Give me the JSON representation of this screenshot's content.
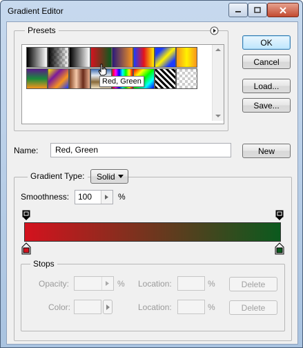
{
  "window": {
    "title": "Gradient Editor"
  },
  "titlebar": {
    "min_icon": "minimize-icon",
    "max_icon": "maximize-icon",
    "close_icon": "close-icon"
  },
  "presets": {
    "label": "Presets",
    "menu_icon": "flyout-menu-icon",
    "tooltip": "Red, Green",
    "swatches_row1": [
      {
        "name": "foreground-to-background",
        "css": "linear-gradient(to right,#000,#fff)"
      },
      {
        "name": "foreground-to-transparent",
        "css": "linear-gradient(to right,#000,rgba(0,0,0,0))"
      },
      {
        "name": "black-white",
        "css": "linear-gradient(to right,#000,#fff)"
      },
      {
        "name": "red-green",
        "css": "linear-gradient(to right,#d4121e,#0b5a1e)"
      },
      {
        "name": "violet-orange",
        "css": "linear-gradient(to right,#2a1a7a,#f7941d)"
      },
      {
        "name": "blue-red-yellow",
        "css": "linear-gradient(to right,#1c3cff,#e4141e,#fff200)"
      },
      {
        "name": "blue-yellow-blue",
        "css": "linear-gradient(135deg,#1c3cff 20%,#fff200 50%,#1c3cff 80%)"
      },
      {
        "name": "orange-yellow-orange",
        "css": "linear-gradient(to right,#f7941d,#fff200,#f7941d)"
      }
    ],
    "swatches_row2": [
      {
        "name": "violet-green-orange",
        "css": "linear-gradient(to bottom,#5a1a8a,#1a8a3a,#f7941d)"
      },
      {
        "name": "yellow-violet-orange-blue",
        "css": "linear-gradient(135deg,#fff200,#7a1a9a,#f7941d,#1c3cff)"
      },
      {
        "name": "copper",
        "css": "linear-gradient(to right,#8a4a2a,#f5c8a8,#6a2a1a,#e8b090)"
      },
      {
        "name": "chrome",
        "css": "linear-gradient(to bottom,#3a6ab0,#e0e8f0,#8a6a3a,#f0e0c0)"
      },
      {
        "name": "spectrum",
        "css": "linear-gradient(to right,#ff0000,#ff00ff,#0000ff,#00ffff,#00ff00,#ffff00,#ff0000)"
      },
      {
        "name": "transparent-rainbow",
        "css": "linear-gradient(135deg,#ff0000,#ffff00,#00ff00,#00ffff,#0000ff)"
      },
      {
        "name": "transparent-stripes",
        "css": "repeating-linear-gradient(45deg,#000 0 3px,#fff 3px 6px)"
      },
      {
        "name": "neutral-density",
        "css": "transparent"
      }
    ]
  },
  "buttons": {
    "ok": "OK",
    "cancel": "Cancel",
    "load": "Load...",
    "save": "Save...",
    "new": "New"
  },
  "name": {
    "label": "Name:",
    "value": "Red, Green"
  },
  "gradient_type": {
    "label": "Gradient Type:",
    "value": "Solid"
  },
  "smoothness": {
    "label": "Smoothness:",
    "value": "100",
    "unit": "%"
  },
  "gradient": {
    "start_color": "#d4121e",
    "end_color": "#0b5a1e"
  },
  "stops": {
    "label": "Stops",
    "opacity_label": "Opacity:",
    "opacity_unit": "%",
    "color_label": "Color:",
    "location_label": "Location:",
    "location_unit": "%",
    "delete": "Delete"
  }
}
